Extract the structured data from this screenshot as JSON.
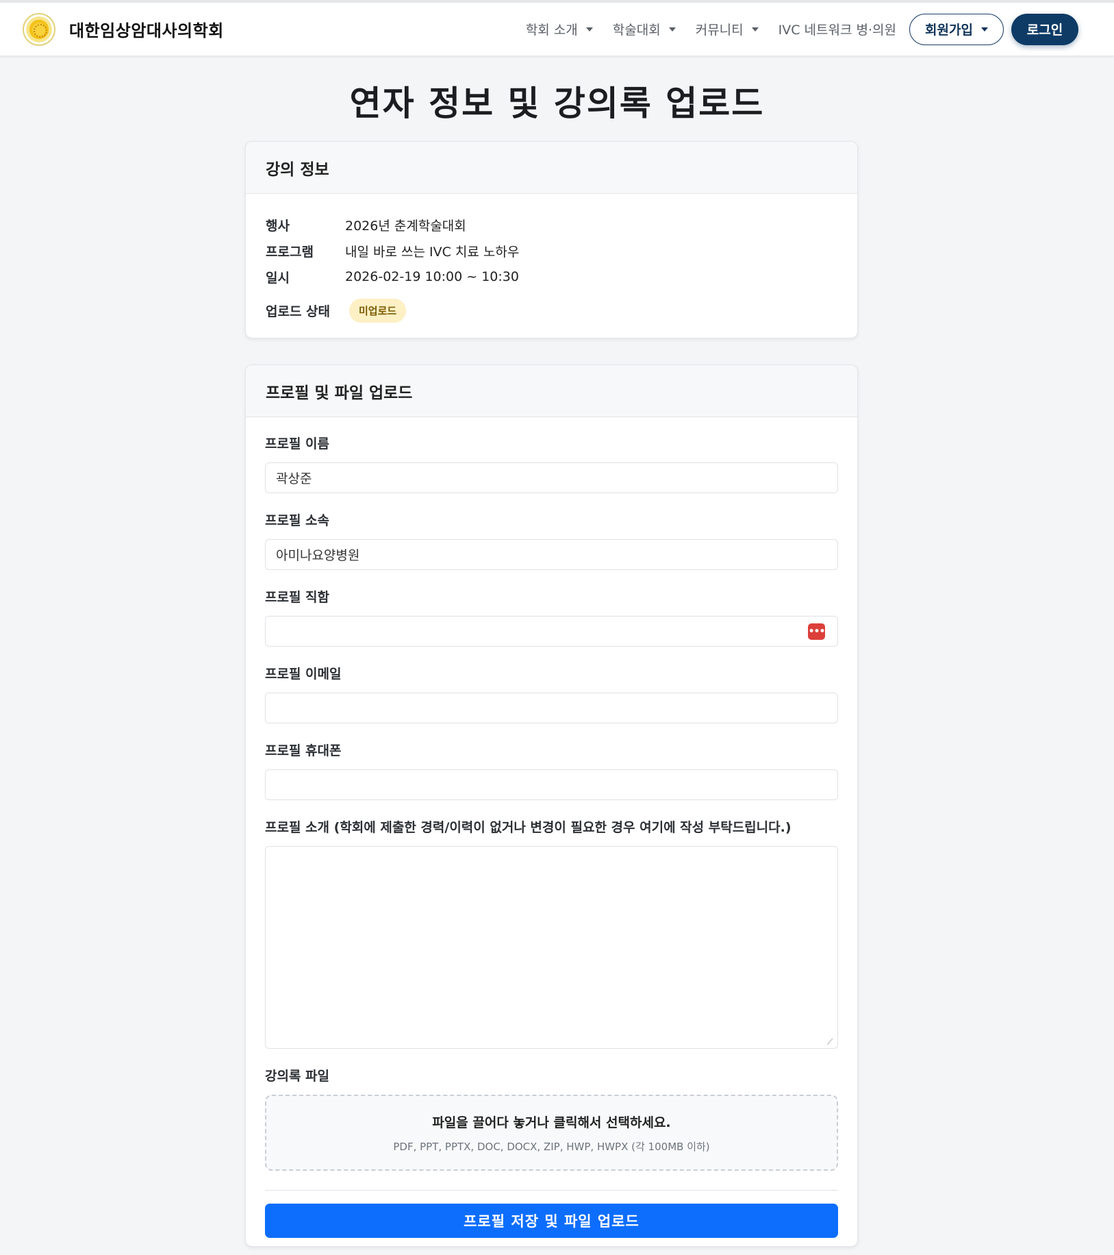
{
  "navbar": {
    "brand_name": "대한임상암대사의학회",
    "items": [
      {
        "label": "학회 소개"
      },
      {
        "label": "학술대회"
      },
      {
        "label": "커뮤니티"
      },
      {
        "label": "IVC 네트워크 병·의원"
      }
    ],
    "signup_label": "회원가입",
    "login_label": "로그인"
  },
  "page_title": "연자 정보 및 강의록 업로드",
  "lecture_info": {
    "header": "강의 정보",
    "rows": [
      {
        "key": "행사",
        "value": "2026년 춘계학술대회"
      },
      {
        "key": "프로그램",
        "value": "내일 바로 쓰는 IVC 치료 노하우"
      },
      {
        "key": "일시",
        "value": "2026-02-19 10:00 ~ 10:30"
      }
    ],
    "status_key": "업로드 상태",
    "status_value": "미업로드"
  },
  "profile_form": {
    "header": "프로필 및 파일 업로드",
    "name_label": "프로필 이름",
    "name_value": "곽상준",
    "affiliation_label": "프로필 소속",
    "affiliation_value": "아미나요양병원",
    "title_label": "프로필 직함",
    "title_value": "",
    "email_label": "프로필 이메일",
    "email_value": "",
    "phone_label": "프로필 휴대폰",
    "phone_value": "",
    "bio_label": "프로필 소개 (학회에 제출한 경력/이력이 없거나 변경이 필요한 경우 여기에 작성 부탁드립니다.)",
    "bio_value": "",
    "file_label": "강의록 파일",
    "dropzone_title": "파일을 끌어다 놓거나 클릭해서 선택하세요.",
    "dropzone_sub": "PDF, PPT, PPTX, DOC, DOCX, ZIP, HWP, HWPX (각 100MB 이하)",
    "submit_label": "프로필 저장 및 파일 업로드"
  },
  "icons": {
    "password_manager": "password-dots-icon",
    "caret": "caret-down-icon"
  },
  "colors": {
    "primary": "#0d6efd",
    "brand_navy": "#0d3b66",
    "badge_bg": "#fdf0c5",
    "password_icon": "#dc3f3a"
  }
}
